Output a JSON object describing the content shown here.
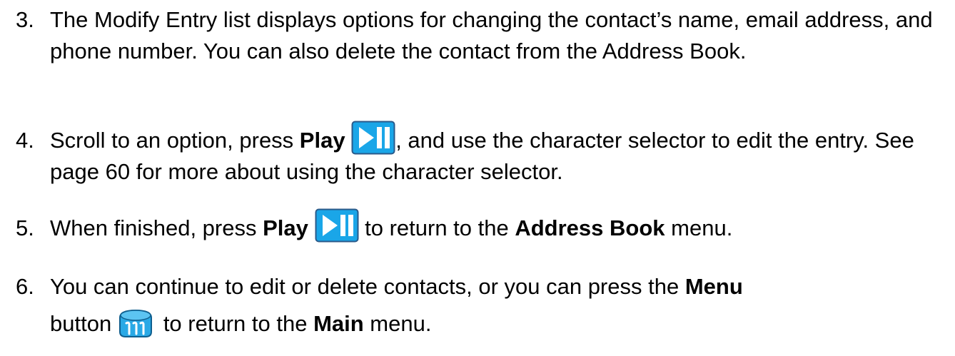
{
  "steps": [
    {
      "number": "3.",
      "text": "The Modify Entry list displays options for changing the contact’s name, email address, and phone number. You can also delete the contact from the Address Book."
    },
    {
      "number": "4.",
      "pre": "Scroll to an option, press ",
      "bold1": "Play",
      "post": ", and use the character selector to edit the entry. See page 60 for more about using the character selector.",
      "icon": "play-pause-icon"
    },
    {
      "number": "5.",
      "pre": "When finished, press ",
      "bold1": "Play",
      "mid": " to return to the ",
      "bold2": "Address Book",
      "post": " menu.",
      "icon": "play-pause-icon"
    },
    {
      "number": "6.",
      "pre": "You can continue to edit or delete contacts, or you can press the ",
      "bold1": "Menu",
      "mid": " button",
      "mid2": " to return to the ",
      "bold2": "Main",
      "post": " menu.",
      "icon": "menu-button-icon"
    }
  ],
  "colors": {
    "icon_blue": "#1aa6e8",
    "icon_border": "#2a5a8a",
    "icon_white": "#ffffff",
    "menu_blue": "#29a9e6",
    "menu_dark": "#0f5f8f"
  }
}
